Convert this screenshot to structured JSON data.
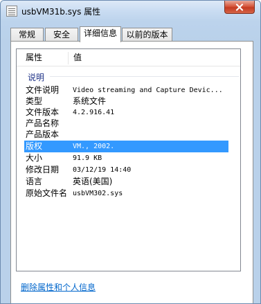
{
  "window": {
    "title": "usbVM31b.sys 属性"
  },
  "tabs": [
    {
      "label": "常规"
    },
    {
      "label": "安全"
    },
    {
      "label": "详细信息"
    },
    {
      "label": "以前的版本"
    }
  ],
  "columns": {
    "property": "属性",
    "value": "值"
  },
  "group": {
    "label": "说明"
  },
  "rows": [
    {
      "key": "文件说明",
      "value": "Video streaming and Capture Devic..."
    },
    {
      "key": "类型",
      "value": "系统文件"
    },
    {
      "key": "文件版本",
      "value": "4.2.916.41"
    },
    {
      "key": "产品名称",
      "value": ""
    },
    {
      "key": "产品版本",
      "value": ""
    },
    {
      "key": "版权",
      "value": "VM., 2002."
    },
    {
      "key": "大小",
      "value": "91.9 KB"
    },
    {
      "key": "修改日期",
      "value": "03/12/19 14:40"
    },
    {
      "key": "语言",
      "value": "英语(美国)"
    },
    {
      "key": "原始文件名",
      "value": "usbVM302.sys"
    }
  ],
  "footer": {
    "link": "删除属性和个人信息"
  },
  "colors": {
    "selection": "#3399ff",
    "link": "#0066cc",
    "group_label": "#1e3287"
  }
}
